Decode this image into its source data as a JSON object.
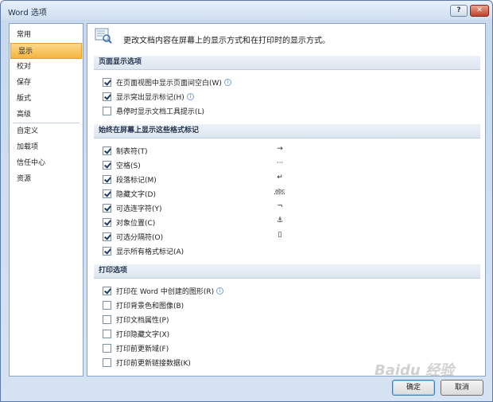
{
  "window": {
    "title": "Word 选项"
  },
  "titlebar": {
    "help_label": "?",
    "close_label": "✕"
  },
  "sidebar": {
    "items": [
      {
        "label": "常用"
      },
      {
        "label": "显示"
      },
      {
        "label": "校对"
      },
      {
        "label": "保存"
      },
      {
        "label": "版式"
      },
      {
        "label": "高级"
      },
      {
        "label": "自定义"
      },
      {
        "label": "加载项"
      },
      {
        "label": "信任中心"
      },
      {
        "label": "资源"
      }
    ],
    "selected": "显示"
  },
  "main": {
    "header_text": "更改文档内容在屏幕上的显示方式和在打印时的显示方式。",
    "sections": [
      {
        "title": "页面显示选项",
        "options": [
          {
            "label": "在页面视图中显示页面间空白(W)",
            "checked": true,
            "info": true
          },
          {
            "label": "显示突出显示标记(H)",
            "checked": true,
            "info": true
          },
          {
            "label": "悬停时显示文档工具提示(L)",
            "checked": false,
            "info": false
          }
        ]
      },
      {
        "title": "始终在屏幕上显示这些格式标记",
        "options": [
          {
            "label": "制表符(T)",
            "checked": true,
            "mark": "→"
          },
          {
            "label": "空格(S)",
            "checked": true,
            "mark": "···"
          },
          {
            "label": "段落标记(M)",
            "checked": true,
            "mark": "↵"
          },
          {
            "label": "隐藏文字(D)",
            "checked": true,
            "mark": "abc"
          },
          {
            "label": "可选连字符(Y)",
            "checked": true,
            "mark": "¬"
          },
          {
            "label": "对象位置(C)",
            "checked": true,
            "mark": "⚓"
          },
          {
            "label": "可选分隔符(O)",
            "checked": true,
            "mark": "▯"
          },
          {
            "label": "显示所有格式标记(A)",
            "checked": true,
            "mark": ""
          }
        ]
      },
      {
        "title": "打印选项",
        "options": [
          {
            "label": "打印在 Word 中创建的图形(R)",
            "checked": true,
            "info": true
          },
          {
            "label": "打印背景色和图像(B)",
            "checked": false,
            "info": false
          },
          {
            "label": "打印文档属性(P)",
            "checked": false,
            "info": false
          },
          {
            "label": "打印隐藏文字(X)",
            "checked": false,
            "info": false
          },
          {
            "label": "打印前更新域(F)",
            "checked": false,
            "info": false
          },
          {
            "label": "打印前更新链接数据(K)",
            "checked": false,
            "info": false
          }
        ]
      }
    ]
  },
  "footer": {
    "ok_label": "确定",
    "cancel_label": "取消"
  },
  "watermark": "Baidu 经验",
  "colors": {
    "selected_bg": "#f5b440",
    "section_bg": "#dde5f0",
    "window_bg": "#c9daee"
  }
}
